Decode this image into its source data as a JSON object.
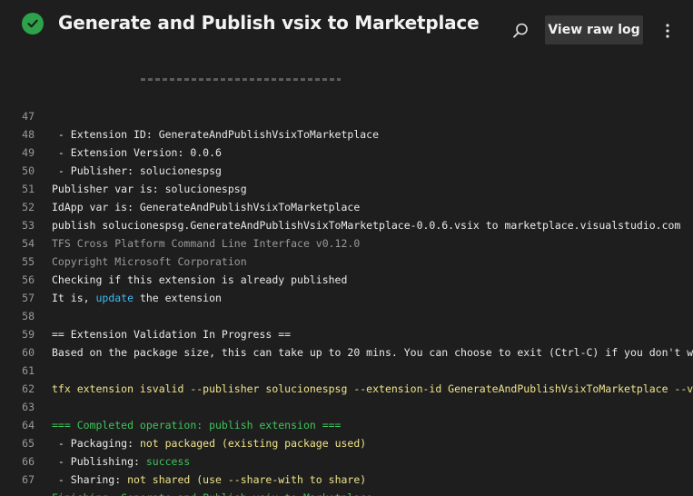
{
  "header": {
    "title": "Generate and Publish vsix to Marketplace",
    "status_icon": "check-circle-icon",
    "status_color": "#2ca34a",
    "search_icon": "search-icon",
    "raw_log_label": "View raw log",
    "more_icon": "more-vertical-icon"
  },
  "log": {
    "lines": [
      {
        "n": "47",
        "t": " - Extension ID: GenerateAndPublishVsixToMarketplace"
      },
      {
        "n": "48",
        "t": " - Extension Version: 0.0.6"
      },
      {
        "n": "49",
        "t": " - Publisher: solucionespsg"
      },
      {
        "n": "50",
        "t": "Publisher var is: solucionespsg"
      },
      {
        "n": "51",
        "t": "IdApp var is: GenerateAndPublishVsixToMarketplace"
      },
      {
        "n": "52",
        "t": "publish solucionespsg.GenerateAndPublishVsixToMarketplace-0.0.6.vsix to marketplace.visualstudio.com"
      },
      {
        "n": "53",
        "t": "TFS Cross Platform Command Line Interface v0.12.0"
      },
      {
        "n": "54",
        "t": "Copyright Microsoft Corporation"
      },
      {
        "n": "55",
        "t": "Checking if this extension is already published"
      },
      {
        "n": "56",
        "a": "It is, ",
        "b": "update",
        "c": " the extension"
      },
      {
        "n": "57",
        "t": ""
      },
      {
        "n": "58",
        "t": "== Extension Validation In Progress =="
      },
      {
        "n": "59",
        "t": "Based on the package size, this can take up to 20 mins. You can choose to exit (Ctrl-C) if you don't want t"
      },
      {
        "n": "60",
        "t": ""
      },
      {
        "n": "61",
        "t": "tfx extension isvalid --publisher solucionespsg --extension-id GenerateAndPublishVsixToMarketplace --versio"
      },
      {
        "n": "62",
        "t": ""
      },
      {
        "n": "63",
        "t": "=== Completed operation: publish extension ==="
      },
      {
        "n": "64",
        "a": " - Packaging: ",
        "b": "not packaged (existing package used)"
      },
      {
        "n": "65",
        "a": " - Publishing: ",
        "b": "success"
      },
      {
        "n": "66",
        "a": " - Sharing: ",
        "b": "not shared (use --share-with to share)"
      },
      {
        "n": "67",
        "t": "Finishing: Generate and Publish vsix to Marketplace"
      }
    ]
  },
  "colors": {
    "background": "#1e1e1e",
    "line_number": "#9a9a9a",
    "highlight_cyan": "#3dbbf1",
    "highlight_yellow": "#f0e38a",
    "highlight_green": "#3fc45b"
  }
}
